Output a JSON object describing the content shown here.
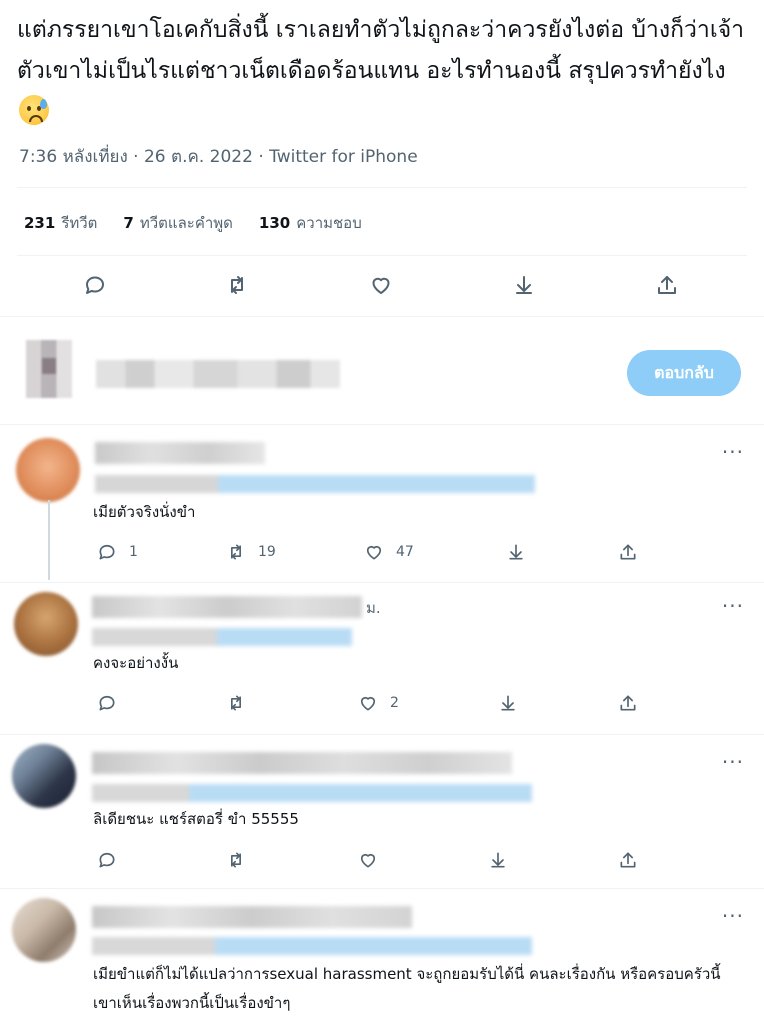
{
  "tweet": {
    "text": "แต่ภรรยาเขาโอเคกับสิ่งนี้ เราเลยทำตัวไม่ถูกละว่าควรยังไงต่อ บ้างก็ว่าเจ้าตัวเขาไม่เป็นไรแต่ชาวเน็ตเดือดร้อนแทน อะไรทำนองนี้ สรุปควรทำยังไง",
    "emoji": "anxious-face-with-sweat-emoji",
    "time": "7:36 หลังเที่ยง · 26 ต.ค. 2022 · Twitter for iPhone"
  },
  "stats": {
    "retweets_count": "231",
    "retweets_label": "รีทวีต",
    "quotes_count": "7",
    "quotes_label": "ทวีตและคำพูด",
    "likes_count": "130",
    "likes_label": "ความชอบ"
  },
  "compose": {
    "reply_button": "ตอบกลับ"
  },
  "replies": [
    {
      "text": "เมียตัวจริงนั่งขำ",
      "reply_count": "1",
      "retweet_count": "19",
      "like_count": "47"
    },
    {
      "name_suffix": "ม.",
      "text": "คงจะอย่างงั้น",
      "reply_count": "",
      "retweet_count": "",
      "like_count": "2"
    },
    {
      "text": "ลิเดียชนะ แชร์สตอรี่ ขำ 55555",
      "reply_count": "",
      "retweet_count": "",
      "like_count": ""
    },
    {
      "text": "เมียขำแต่ก็ไม่ได้แปลว่าการsexual harassment จะถูกยอมรับได้นี่ คนละเรื่องกัน หรือครอบครัวนี้เขาเห็นเรื่องพวกนี้เป็นเรื่องขำๆ"
    }
  ],
  "more_label": "···",
  "colors": {
    "accent": "#1d9bf0",
    "reply_button_disabled": "#8ecdf8",
    "muted": "#536471",
    "divider": "#eff3f4"
  }
}
